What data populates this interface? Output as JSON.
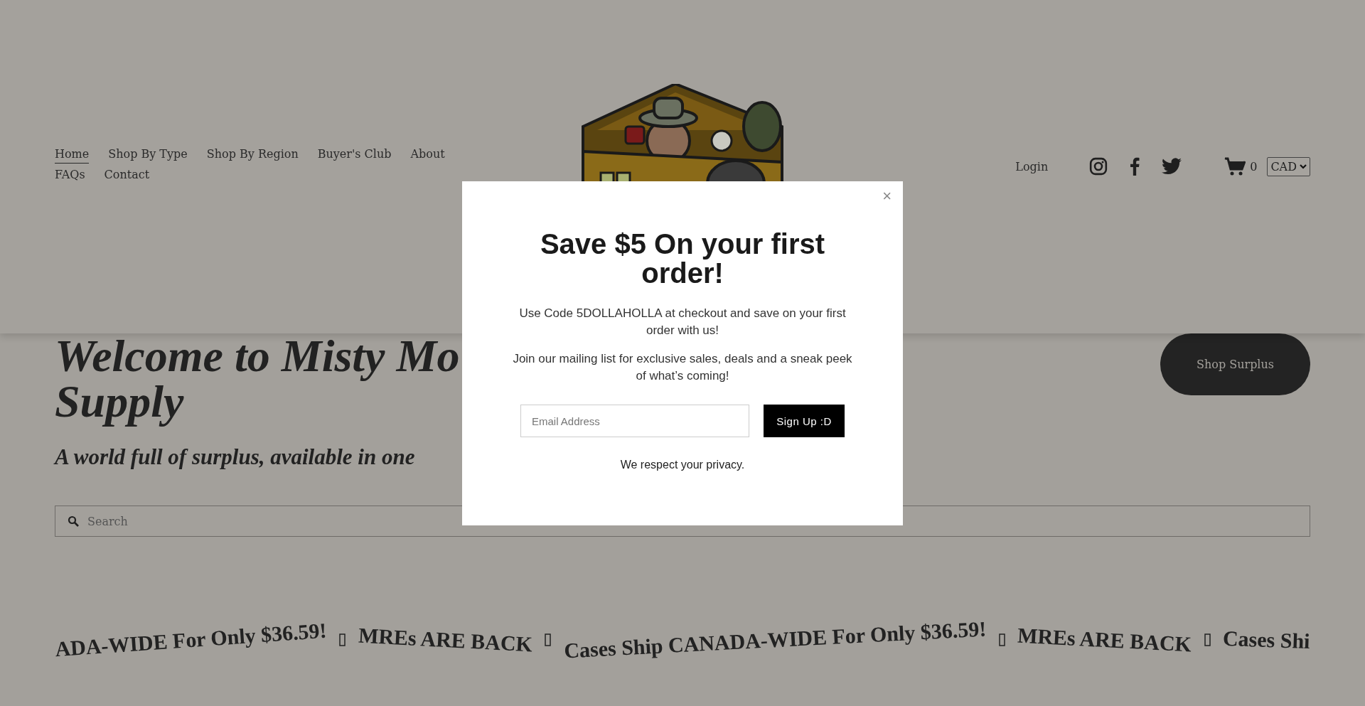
{
  "header": {
    "nav": [
      {
        "label": "Home",
        "selected": true
      },
      {
        "label": "Shop By Type",
        "selected": false
      },
      {
        "label": "Shop By Region",
        "selected": false
      },
      {
        "label": "Buyer's Club",
        "selected": false
      },
      {
        "label": "About",
        "selected": false
      },
      {
        "label": "FAQs",
        "selected": false
      },
      {
        "label": "Contact",
        "selected": false
      }
    ],
    "login": "Login",
    "cart_count": "0",
    "currency": "CAD"
  },
  "hero": {
    "title_lines": [
      "Welcome to Misty Mo",
      "Supply"
    ],
    "subtitle": "A world full of surplus, available in one",
    "button": "Shop Surplus"
  },
  "search": {
    "placeholder": "Search"
  },
  "marquee": {
    "items": [
      {
        "kind": "text",
        "text": "ADA-WIDE For Only $36.59!"
      },
      {
        "kind": "separator"
      },
      {
        "kind": "text",
        "text": "MREs ARE BACK"
      },
      {
        "kind": "separator"
      },
      {
        "kind": "text",
        "text": "Cases Ship CANADA-WIDE For Only $36.59!"
      },
      {
        "kind": "separator"
      },
      {
        "kind": "text",
        "text": "MREs ARE BACK"
      },
      {
        "kind": "separator"
      },
      {
        "kind": "text",
        "text": "Cases Shi"
      }
    ]
  },
  "popup": {
    "close": "×",
    "title": "Save $5 On your first order!",
    "paragraphs": [
      "Use Code 5DOLLAHOLLA at checkout and save on your first order with us!",
      "Join our mailing list for exclusive sales, deals and a sneak peek of what’s coming!"
    ],
    "email": {
      "placeholder": "Email Address"
    },
    "button": "Sign Up :D",
    "note": "We respect your privacy."
  }
}
